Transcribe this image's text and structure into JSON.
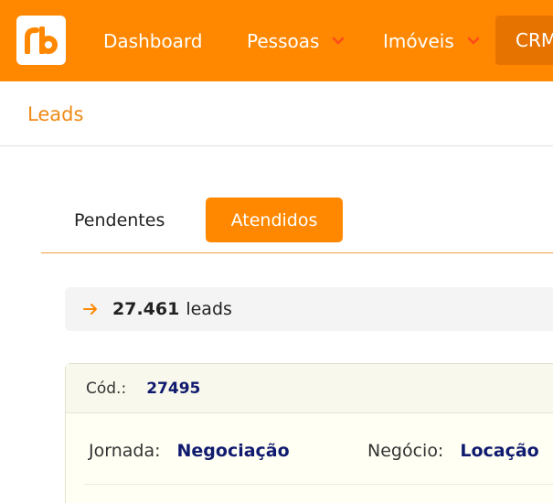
{
  "nav": {
    "logo_text": "rb",
    "items": [
      {
        "label": "Dashboard",
        "has_dropdown": false
      },
      {
        "label": "Pessoas",
        "has_dropdown": true
      },
      {
        "label": "Imóveis",
        "has_dropdown": true
      },
      {
        "label": "CRM",
        "active": true
      }
    ],
    "colors": {
      "bar": "#ff8800",
      "active": "#e67300",
      "chevron": "#ff4a1a"
    }
  },
  "breadcrumb": {
    "title": "Leads"
  },
  "tabs": [
    {
      "label": "Pendentes",
      "active": false
    },
    {
      "label": "Atendidos",
      "active": true
    }
  ],
  "summary": {
    "count": "27.461",
    "unit": "leads",
    "icon": "arrow-right-icon"
  },
  "lead": {
    "code_label": "Cód.:",
    "code_value": "27495",
    "jornada_label": "Jornada:",
    "jornada_value": "Negociação",
    "negocio_label": "Negócio:",
    "negocio_value": "Locação"
  }
}
